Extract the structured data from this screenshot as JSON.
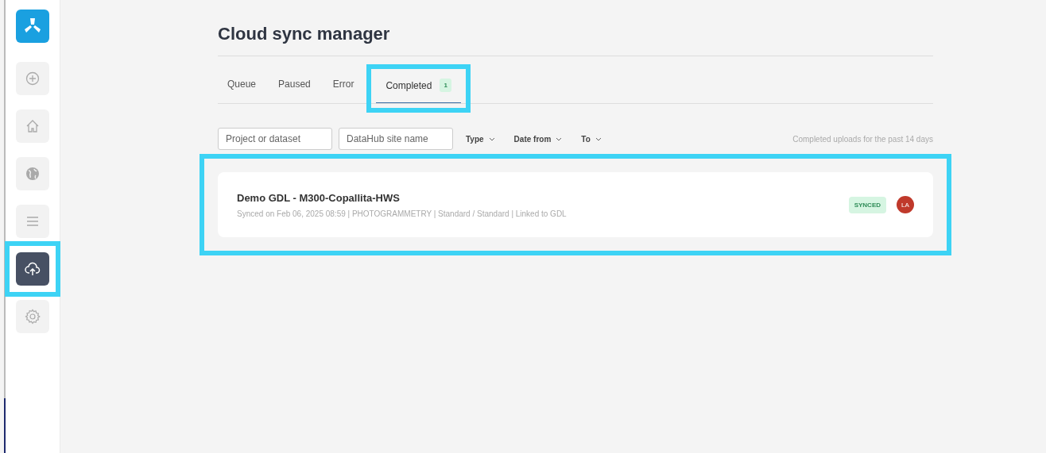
{
  "sidebar": {
    "items": [
      {
        "kind": "add",
        "selected": false,
        "highlighted": false
      },
      {
        "kind": "home",
        "selected": false,
        "highlighted": false
      },
      {
        "kind": "globe",
        "selected": false,
        "highlighted": false
      },
      {
        "kind": "list",
        "selected": false,
        "highlighted": false
      },
      {
        "kind": "upload",
        "selected": true,
        "highlighted": true
      },
      {
        "kind": "settings",
        "selected": false,
        "highlighted": false
      }
    ]
  },
  "title": "Cloud sync manager",
  "tabs": [
    {
      "label": "Queue",
      "selected": false,
      "highlighted": false
    },
    {
      "label": "Paused",
      "selected": false,
      "highlighted": false
    },
    {
      "label": "Error",
      "selected": false,
      "highlighted": false
    },
    {
      "label": "Completed",
      "count": "1",
      "selected": true,
      "highlighted": true
    }
  ],
  "filters": {
    "fields": [
      {
        "placeholder": "Project or dataset"
      },
      {
        "placeholder": "DataHub site name"
      }
    ],
    "dropdowns": [
      "Type",
      "Date from",
      "To"
    ],
    "note": "Completed uploads for the past 14 days"
  },
  "list_highlighted": true,
  "items": [
    {
      "title": "Demo GDL - M300-Copallita-HWS",
      "details": "Synced on Feb 06, 2025 08:59 | PHOTOGRAMMETRY | Standard / Standard | Linked to GDL",
      "status": "SYNCED",
      "avatar": "LA"
    }
  ]
}
